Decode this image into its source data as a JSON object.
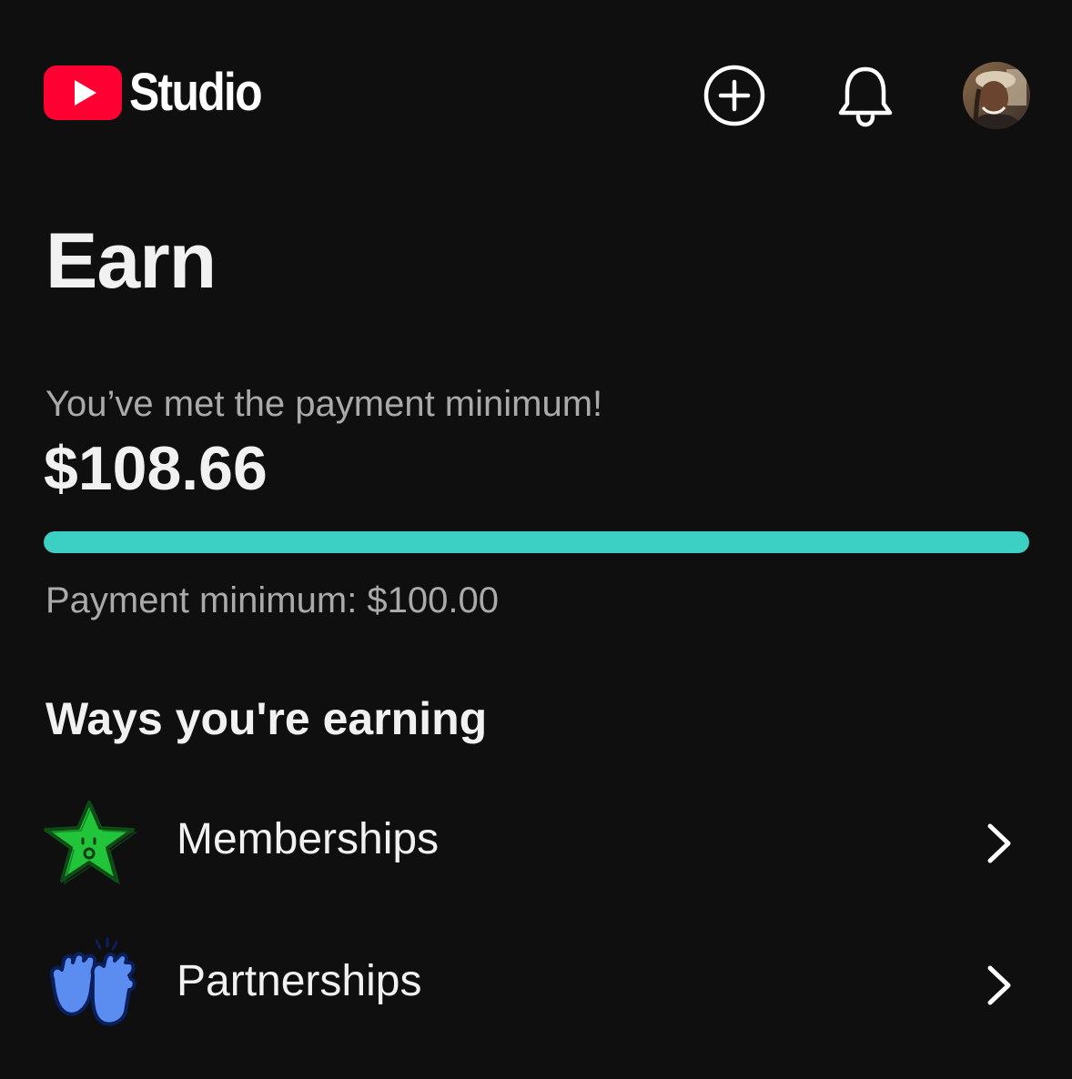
{
  "header": {
    "logo_text": "Studio",
    "create_button": "create-icon",
    "notifications_button": "bell-icon",
    "avatar": "account-avatar"
  },
  "page": {
    "title": "Earn"
  },
  "payment": {
    "status": "You’ve met the payment minimum!",
    "amount": "$108.66",
    "minimum_label": "Payment minimum: $100.00",
    "progress_percent": 100,
    "progress_color": "#3ccfc3"
  },
  "earning": {
    "title": "Ways you're earning",
    "items": [
      {
        "label": "Memberships",
        "icon": "membership-star-icon"
      },
      {
        "label": "Partnerships",
        "icon": "partnership-hands-icon"
      }
    ]
  },
  "colors": {
    "background": "#0f0f0f",
    "brand_red": "#ff0033",
    "accent_teal": "#3ccfc3"
  }
}
